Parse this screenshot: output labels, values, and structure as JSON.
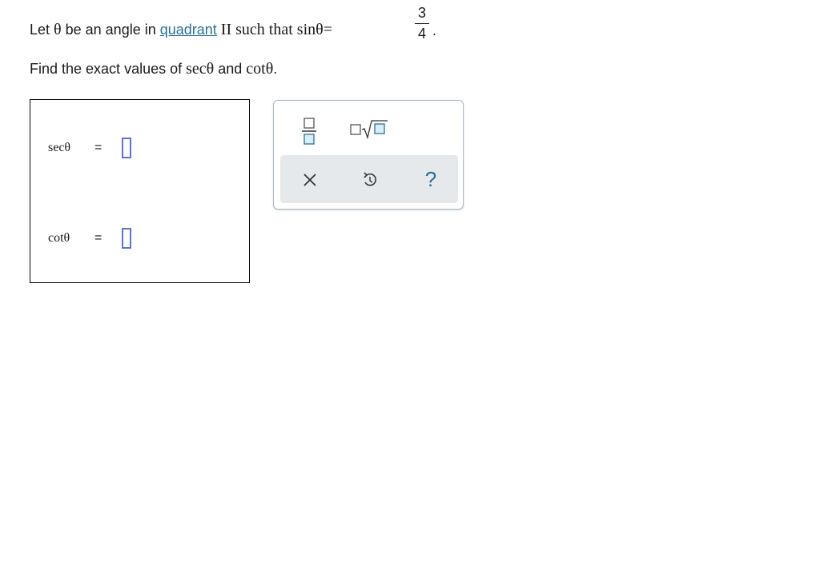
{
  "problem": {
    "line1": {
      "prefix": "Let ",
      "theta": "θ",
      "mid1": " be an angle in ",
      "link_text": "quadrant",
      "mid2": " II such that ",
      "sin_expr": "sinθ",
      "equals": "=",
      "fraction": {
        "numerator": "3",
        "denominator": "4"
      },
      "period": "."
    },
    "line2": {
      "prefix": "Find the exact values of ",
      "sec_expr": "secθ",
      "mid": " and ",
      "cot_expr": "cotθ",
      "suffix": "."
    }
  },
  "answers": [
    {
      "label": "secθ",
      "equals": "=",
      "value": ""
    },
    {
      "label": "cotθ",
      "equals": "=",
      "value": ""
    }
  ],
  "keypad": {
    "keys": [
      "fraction-icon",
      "square-root-icon"
    ],
    "actions": [
      "clear-icon",
      "undo-icon",
      "help-icon"
    ],
    "help_label": "?",
    "colors": {
      "input_border": "#5b73d6",
      "key_accent": "#2a6f97",
      "action_bar_bg": "#e6e9ec"
    }
  }
}
